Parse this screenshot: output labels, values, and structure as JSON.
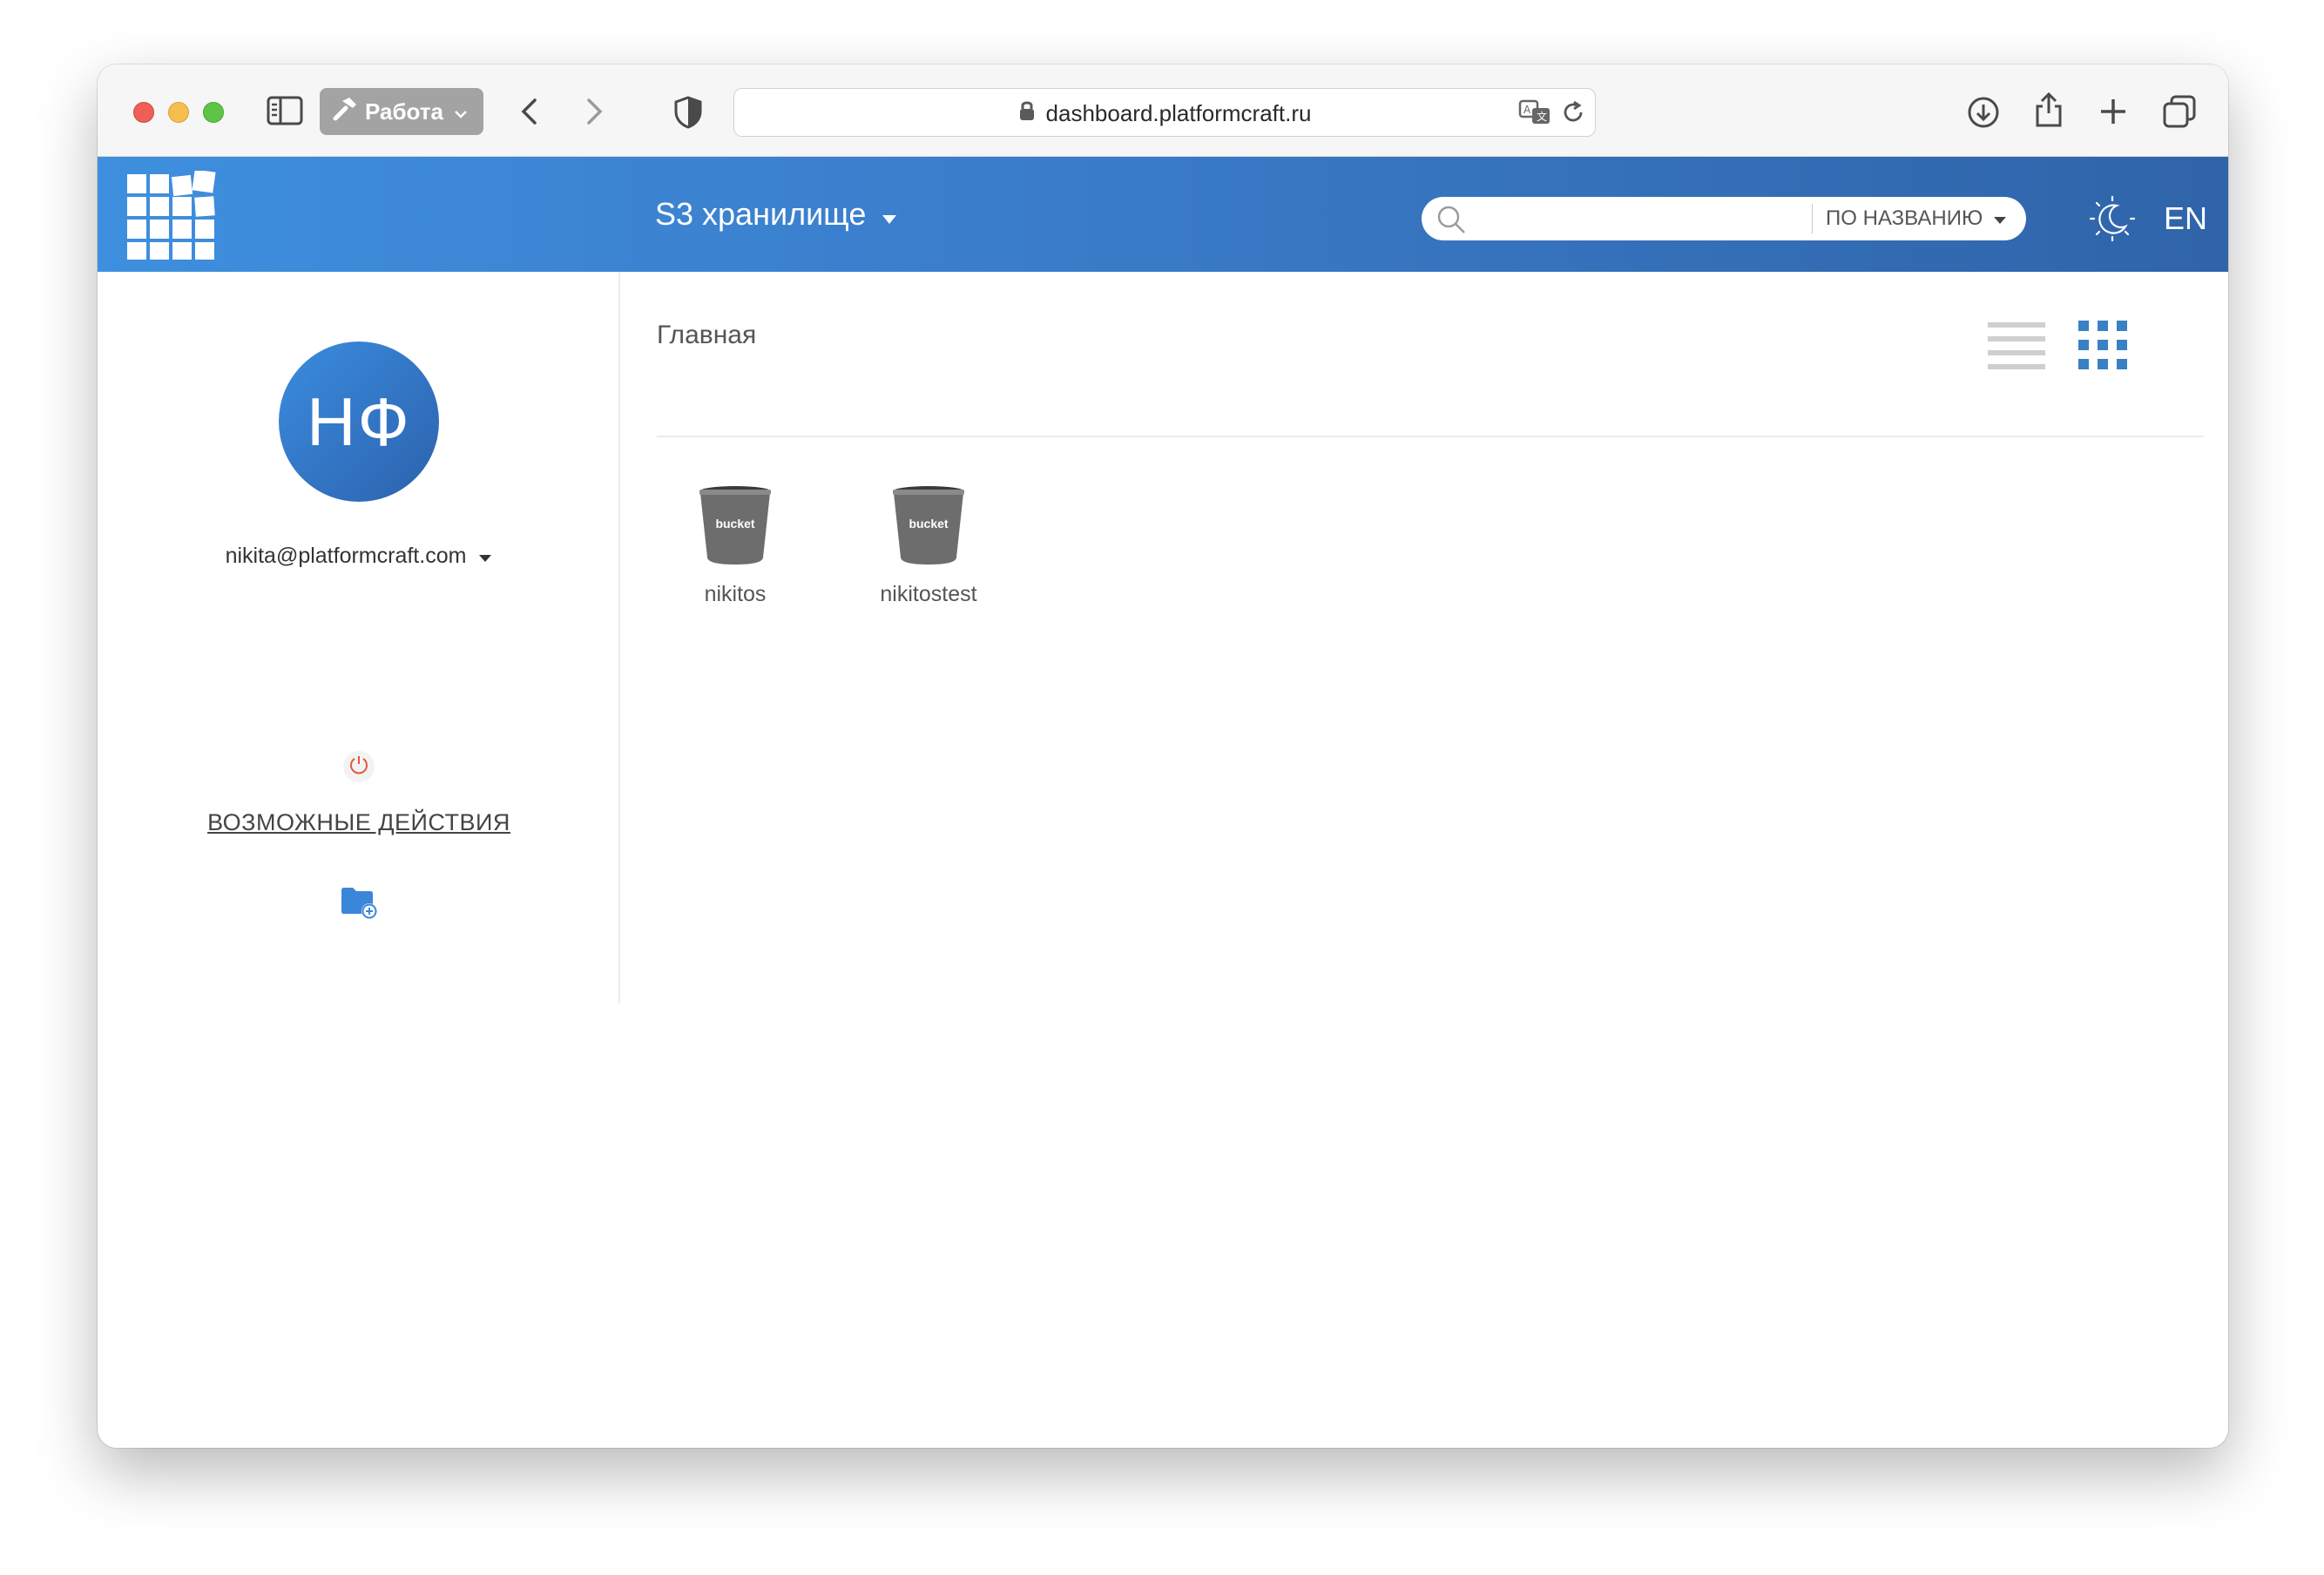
{
  "browser": {
    "profile_label": "Работа",
    "url": "dashboard.platformcraft.ru"
  },
  "header": {
    "section_title": "S3 хранилище",
    "search": {
      "placeholder": "",
      "mode": "ПО НАЗВАНИЮ"
    },
    "language": "EN"
  },
  "sidebar": {
    "avatar_initials": "НФ",
    "user_email": "nikita@platformcraft.com",
    "actions_label": "ВОЗМОЖНЫЕ ДЕЙСТВИЯ"
  },
  "main": {
    "breadcrumb": "Главная",
    "active_view": "grid",
    "buckets": [
      {
        "name": "nikitos",
        "badge": "bucket"
      },
      {
        "name": "nikitostest",
        "badge": "bucket"
      }
    ]
  },
  "colors": {
    "header_start": "#3e8fdf",
    "header_end": "#2f64a9",
    "accent": "#3a86d9",
    "bucket_body": "#6d6d6d",
    "power_icon": "#e25a3a"
  }
}
